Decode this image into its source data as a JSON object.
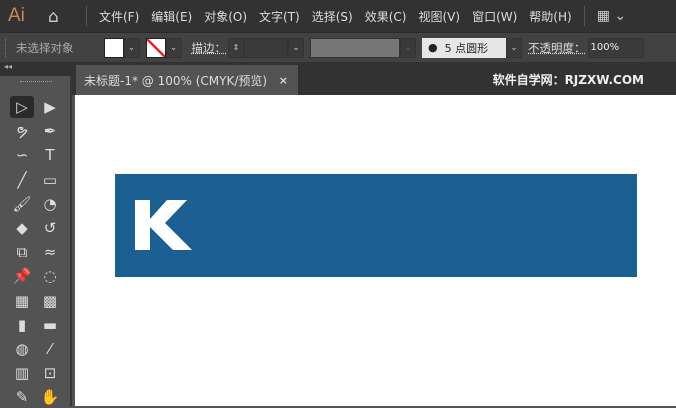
{
  "app": {
    "logo": "Ai"
  },
  "menu": [
    "文件(F)",
    "编辑(E)",
    "对象(O)",
    "文字(T)",
    "选择(S)",
    "效果(C)",
    "视图(V)",
    "窗口(W)",
    "帮助(H)"
  ],
  "control": {
    "selection": "未选择对象",
    "stroke_label": "描边：",
    "brush": "5 点圆形",
    "opacity_label": "不透明度：",
    "opacity": "100%"
  },
  "tab": {
    "title": "未标题-1* @ 100% (CMYK/预览)",
    "close": "×"
  },
  "watermark": "软件自学网：RJZXW.COM",
  "colors": {
    "rect": "#1c5f92"
  },
  "artwork": {
    "letter": "K"
  },
  "tools": [
    [
      "selection",
      "▷"
    ],
    [
      "direct-selection",
      "▶"
    ],
    [
      "lasso",
      "ຯ"
    ],
    [
      "pen",
      "✒"
    ],
    [
      "curvature",
      "∽"
    ],
    [
      "type",
      "T"
    ],
    [
      "line",
      "╱"
    ],
    [
      "rectangle",
      "▭"
    ],
    [
      "paintbrush",
      "🖌"
    ],
    [
      "shaper",
      "◔"
    ],
    [
      "eraser",
      "◆"
    ],
    [
      "rotate",
      "↺"
    ],
    [
      "scale",
      "⧉"
    ],
    [
      "warp",
      "≈"
    ],
    [
      "puppet-warp",
      "📌"
    ],
    [
      "shape-builder",
      "◌"
    ],
    [
      "perspective-grid",
      "▦"
    ],
    [
      "mesh",
      "▩"
    ],
    [
      "gradient",
      "▮"
    ],
    [
      "measure",
      "▬"
    ],
    [
      "blend",
      "◍"
    ],
    [
      "eyedropper",
      "⁄"
    ],
    [
      "graph",
      "▥"
    ],
    [
      "artboard",
      "⊡"
    ],
    [
      "pencil",
      "✎"
    ],
    [
      "hand",
      "✋"
    ]
  ]
}
